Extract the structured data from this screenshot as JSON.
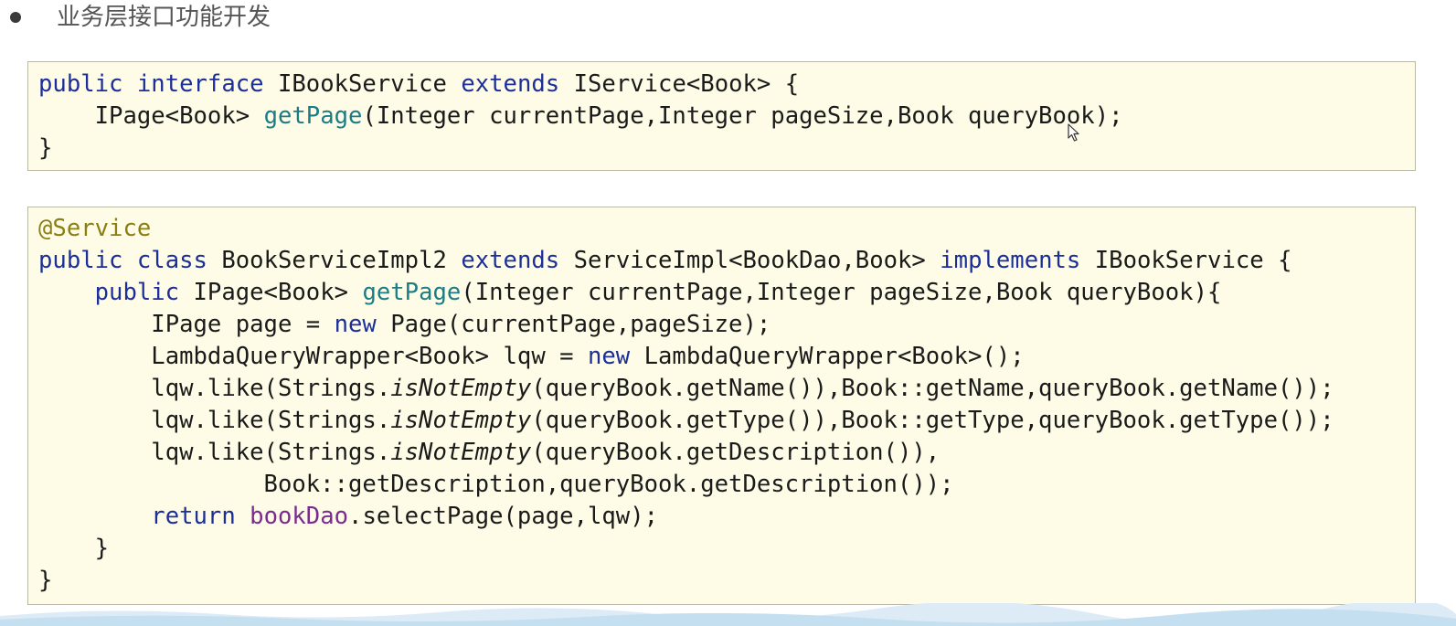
{
  "heading": {
    "bullet": "•",
    "text": "业务层接口功能开发"
  },
  "interface_code": {
    "line1": {
      "kw1": "public",
      "kw2": "interface",
      "name": "IBookService",
      "kw3": "extends",
      "rest": "IService<Book> {"
    },
    "line2": {
      "type": "IPage<Book>",
      "method": "getPage",
      "params": "(Integer currentPage,Integer pageSize,Book queryBook);"
    },
    "line3": "}"
  },
  "impl_code": {
    "annotation": "@Service",
    "class_line": {
      "kw1": "public",
      "kw2": "class",
      "name": "BookServiceImpl2",
      "kw3": "extends",
      "parent": "ServiceImpl<BookDao,Book>",
      "kw4": "implements",
      "iface": "IBookService {"
    },
    "method_line": {
      "kw": "public",
      "type": "IPage<Book>",
      "method": "getPage",
      "params": "(Integer currentPage,Integer pageSize,Book queryBook){"
    },
    "page_line": {
      "pre": "IPage page = ",
      "kw": "new",
      "post": " Page(currentPage,pageSize);"
    },
    "lqw_line": {
      "pre": "LambdaQueryWrapper<Book> lqw = ",
      "kw": "new",
      "post": " LambdaQueryWrapper<Book>();"
    },
    "like_name": {
      "pre": "lqw.like(Strings.",
      "call": "isNotEmpty",
      "post": "(queryBook.getName()),Book::getName,queryBook.getName());"
    },
    "like_type": {
      "pre": "lqw.like(Strings.",
      "call": "isNotEmpty",
      "post": "(queryBook.getType()),Book::getType,queryBook.getType());"
    },
    "like_desc": {
      "pre": "lqw.like(Strings.",
      "call": "isNotEmpty",
      "post": "(queryBook.getDescription()),"
    },
    "like_desc_cont": "Book::getDescription,queryBook.getDescription());",
    "return_line": {
      "kw": "return",
      "field": "bookDao",
      "post": ".selectPage(page,lqw);"
    },
    "close_method": "}",
    "close_class": "}"
  },
  "colors": {
    "keyword": "#1c2f99",
    "annotation": "#8a7f12",
    "method": "#1c7c86",
    "field": "#7b2b8f",
    "box_background": "#fefce6"
  },
  "icons": {
    "cursor": "mouse-pointer-icon"
  }
}
